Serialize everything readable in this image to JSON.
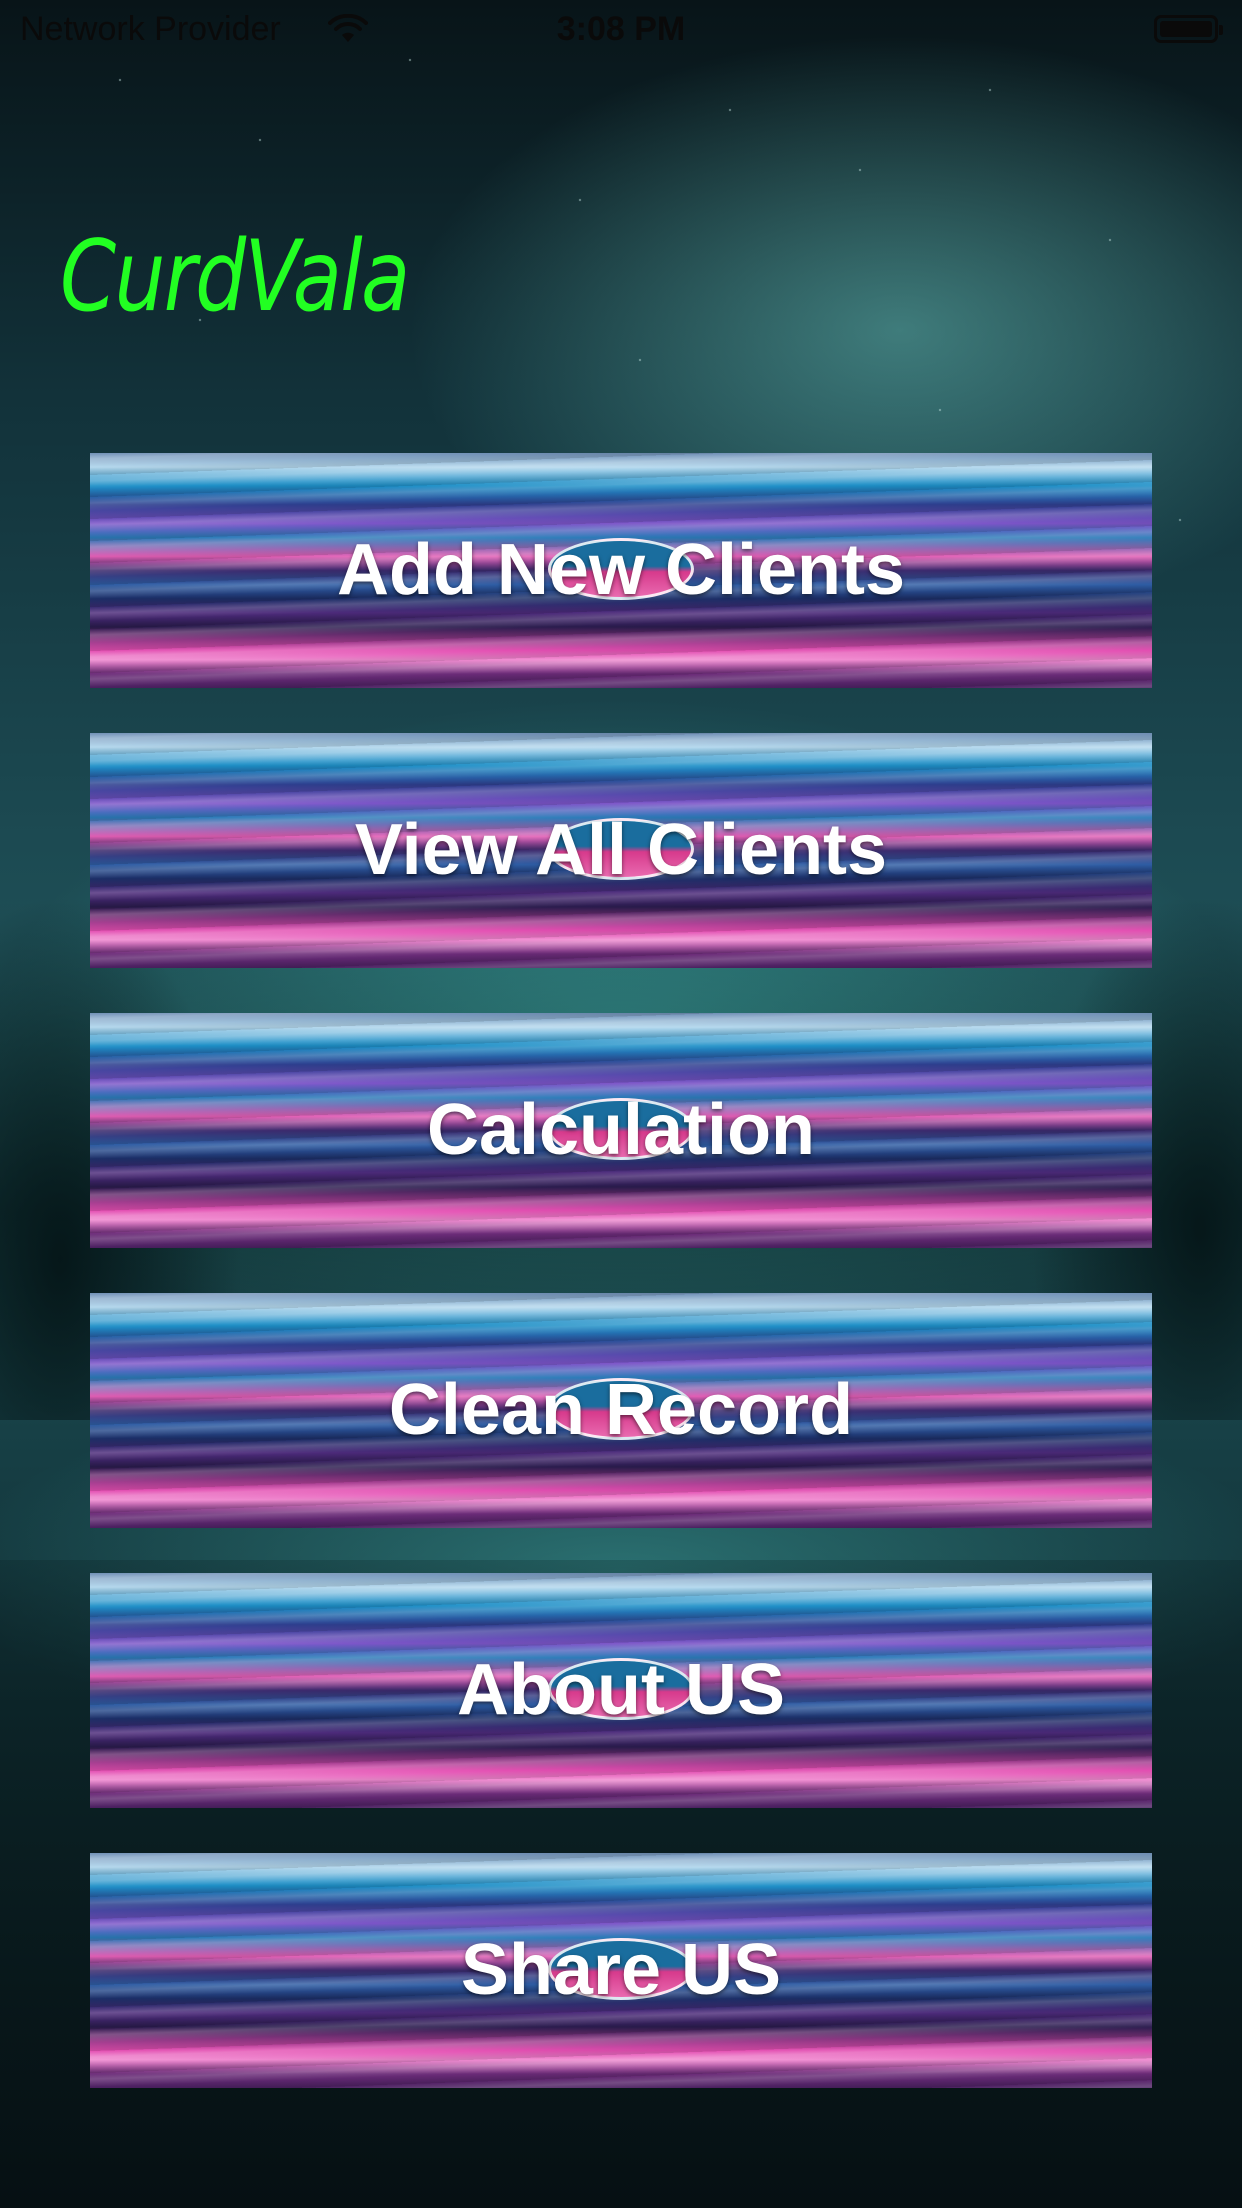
{
  "status_bar": {
    "provider": "Network Provider",
    "time": "3:08 PM",
    "wifi_icon": "wifi-icon",
    "battery_icon": "battery-full-icon"
  },
  "app": {
    "title": "CurdVala",
    "title_color": "#22ff22"
  },
  "menu": {
    "items": [
      {
        "label": "Add New Clients"
      },
      {
        "label": "View All Clients"
      },
      {
        "label": "Calculation"
      },
      {
        "label": "Clean Record"
      },
      {
        "label": "About US"
      },
      {
        "label": "Share US"
      }
    ]
  }
}
